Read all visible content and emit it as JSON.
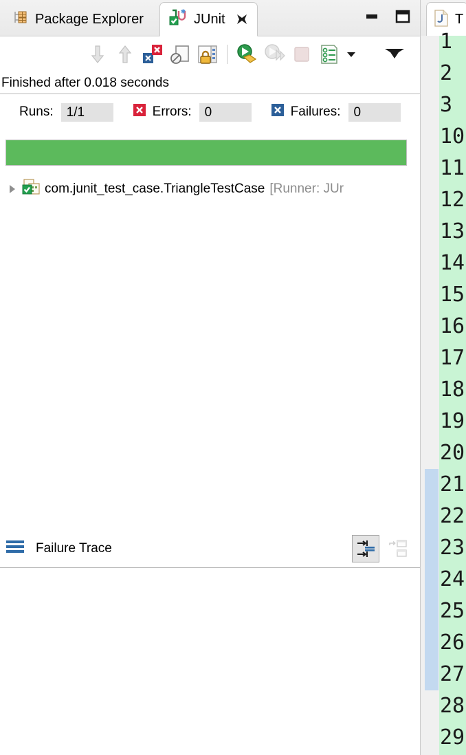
{
  "view": {
    "tabs": [
      {
        "label": "Package Explorer",
        "icon": "package-explorer-icon",
        "active": false,
        "closable": false
      },
      {
        "label": "JUnit",
        "icon": "junit-icon",
        "active": true,
        "closable": true
      }
    ],
    "window_buttons": [
      {
        "name": "minimize-button",
        "icon": "minimize-icon"
      },
      {
        "name": "maximize-button",
        "icon": "maximize-icon"
      }
    ],
    "toolbar": [
      {
        "name": "next-failure-button",
        "icon": "arrow-down-icon",
        "enabled": false
      },
      {
        "name": "previous-failure-button",
        "icon": "arrow-up-icon",
        "enabled": false
      },
      {
        "name": "show-failures-only-button",
        "icon": "failures-only-icon",
        "enabled": true
      },
      {
        "name": "scroll-lock-button",
        "icon": "scroll-lock-icon",
        "enabled": true
      },
      {
        "name": "lock-button",
        "icon": "lock-icon",
        "enabled": true
      },
      {
        "name": "separator",
        "icon": "separator",
        "enabled": true
      },
      {
        "name": "rerun-test-button",
        "icon": "rerun-icon",
        "enabled": true
      },
      {
        "name": "rerun-failed-button",
        "icon": "rerun-failed-icon",
        "enabled": false
      },
      {
        "name": "stop-button",
        "icon": "stop-icon",
        "enabled": false
      },
      {
        "name": "test-run-history-button",
        "icon": "history-icon",
        "enabled": true
      },
      {
        "name": "history-dropdown-button",
        "icon": "chevron-down-icon",
        "enabled": true
      },
      {
        "name": "view-menu-button",
        "icon": "view-menu-icon",
        "enabled": true
      }
    ],
    "status_text": "Finished after 0.018 seconds",
    "counters": [
      {
        "name": "runs",
        "label": "Runs:",
        "value": "1/1",
        "icon": null
      },
      {
        "name": "errors",
        "label": "Errors:",
        "value": "0",
        "icon": "error-x-icon"
      },
      {
        "name": "failures",
        "label": "Failures:",
        "value": "0",
        "icon": "failure-x-icon"
      }
    ],
    "progress": {
      "percent": 100,
      "state_color": "#5cba5c"
    },
    "tree": [
      {
        "name": "com.junit_test_case.TriangleTestCase",
        "runner": "[Runner: JUr",
        "expanded": false,
        "status": "passed"
      }
    ],
    "failure_trace": {
      "title": "Failure Trace",
      "icon": "stack-lines-icon",
      "actions": [
        {
          "name": "filter-stack-trace-button",
          "icon": "filter-stack-icon",
          "pressed": true
        },
        {
          "name": "compare-result-button",
          "icon": "compare-icon",
          "pressed": false
        }
      ],
      "content": ""
    }
  },
  "editor": {
    "tab": {
      "label": "T",
      "icon": "java-file-icon"
    },
    "gutter": {
      "line_numbers": [
        "1",
        "2",
        "3",
        "10",
        "11",
        "12",
        "13",
        "14",
        "15",
        "16",
        "17",
        "18",
        "19",
        "20",
        "21",
        "22",
        "23",
        "24",
        "25",
        "26",
        "27",
        "28",
        "29"
      ],
      "changed_lines_from": "21",
      "changed_lines_to": "27",
      "background_color": "#c9f4d4",
      "change_marker_color": "#c3d9f0"
    }
  }
}
